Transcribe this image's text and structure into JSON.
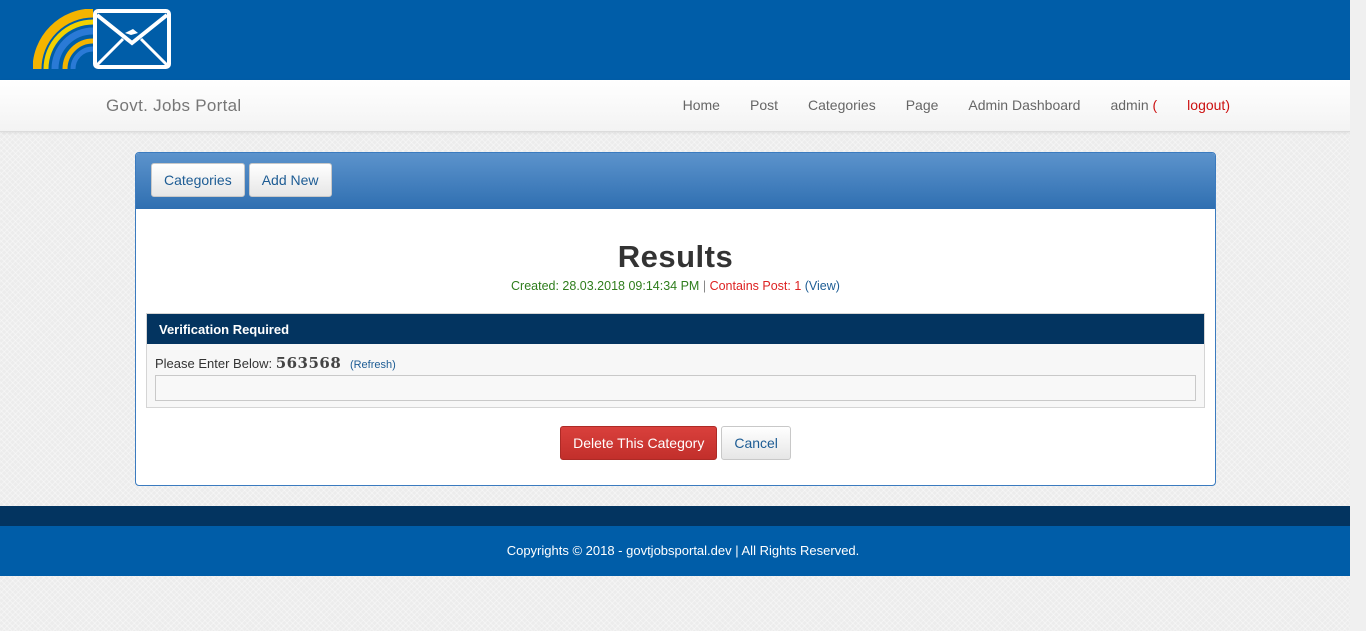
{
  "site": {
    "brand": "Govt. Jobs Portal"
  },
  "nav": {
    "items": [
      "Home",
      "Post",
      "Categories",
      "Page",
      "Admin Dashboard"
    ],
    "user": "admin",
    "logout_open": " (",
    "logout": "logout",
    "logout_close": ")"
  },
  "toolbar": {
    "categories_label": "Categories",
    "add_new_label": "Add New"
  },
  "results": {
    "title": "Results",
    "created_label": "Created: 28.03.2018 09:14:34 PM",
    "separator": " | ",
    "contains_label": "Contains Post: 1",
    "view_open": " (",
    "view_label": "View",
    "view_close": ")"
  },
  "verification": {
    "header": "Verification Required",
    "prompt": "Please Enter Below: ",
    "code": "563568",
    "refresh_label": "(Refresh)",
    "input_value": ""
  },
  "actions": {
    "delete_label": "Delete This Category",
    "cancel_label": "Cancel"
  },
  "footer": {
    "text": "Copyrights © 2018 - govtjobsportal.dev | All Rights Reserved."
  },
  "colors": {
    "header_blue": "#005da8",
    "dark_navy": "#033460",
    "danger": "#c9302c",
    "link": "#1d5c94"
  }
}
